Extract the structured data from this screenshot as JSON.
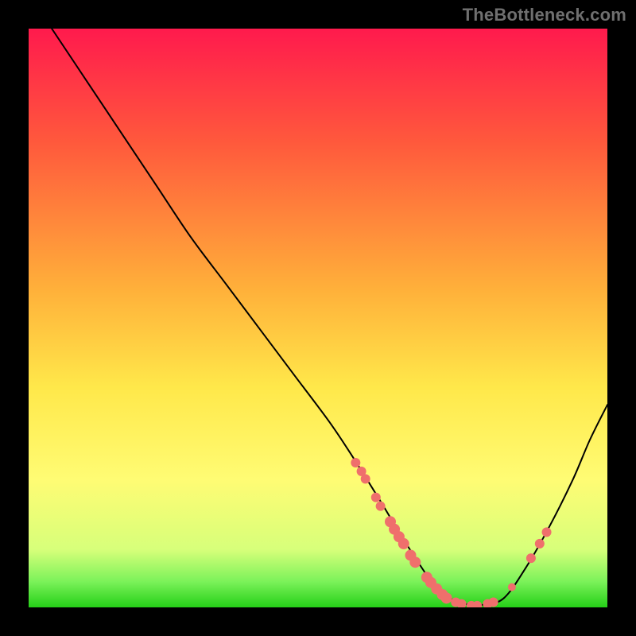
{
  "watermark": "TheBottleneck.com",
  "accent_color": "#ef6f6c",
  "curve_color": "#000000",
  "green_band_top": "#7cf25a",
  "green_band_bottom": "#25d018",
  "chart_data": {
    "type": "line",
    "title": "",
    "xlabel": "",
    "ylabel": "",
    "xlim": [
      0,
      100
    ],
    "ylim": [
      0,
      100
    ],
    "grid": false,
    "background_gradient": [
      {
        "pos": 0.0,
        "color": "#ff1a4d"
      },
      {
        "pos": 0.2,
        "color": "#ff5a3c"
      },
      {
        "pos": 0.45,
        "color": "#ffb03a"
      },
      {
        "pos": 0.62,
        "color": "#ffe84a"
      },
      {
        "pos": 0.78,
        "color": "#fffc74"
      },
      {
        "pos": 0.9,
        "color": "#d7ff7a"
      },
      {
        "pos": 0.955,
        "color": "#7cf25a"
      },
      {
        "pos": 1.0,
        "color": "#25d018"
      }
    ],
    "series": [
      {
        "name": "bottleneck-curve",
        "x": [
          4,
          10,
          16,
          22,
          28,
          34,
          40,
          46,
          52,
          56,
          61,
          64,
          67.5,
          70,
          73,
          75,
          78,
          82,
          86,
          90,
          94,
          97,
          100
        ],
        "y": [
          100,
          91,
          82,
          73,
          64,
          56,
          48,
          40,
          32,
          26,
          18,
          13,
          7.5,
          4,
          1.5,
          0.7,
          0.4,
          1.5,
          7,
          14,
          22,
          29,
          35
        ]
      }
    ],
    "markers": [
      {
        "x": 56.5,
        "y": 25.0,
        "r": 6
      },
      {
        "x": 57.5,
        "y": 23.5,
        "r": 6
      },
      {
        "x": 58.2,
        "y": 22.2,
        "r": 6
      },
      {
        "x": 60.0,
        "y": 19.0,
        "r": 6
      },
      {
        "x": 60.8,
        "y": 17.5,
        "r": 6
      },
      {
        "x": 62.5,
        "y": 14.8,
        "r": 7
      },
      {
        "x": 63.2,
        "y": 13.5,
        "r": 7
      },
      {
        "x": 64.0,
        "y": 12.2,
        "r": 7
      },
      {
        "x": 64.8,
        "y": 11.0,
        "r": 7
      },
      {
        "x": 66.0,
        "y": 9.0,
        "r": 7
      },
      {
        "x": 66.8,
        "y": 7.8,
        "r": 7
      },
      {
        "x": 68.8,
        "y": 5.2,
        "r": 7
      },
      {
        "x": 69.5,
        "y": 4.3,
        "r": 7
      },
      {
        "x": 70.5,
        "y": 3.2,
        "r": 7
      },
      {
        "x": 71.5,
        "y": 2.2,
        "r": 7
      },
      {
        "x": 72.2,
        "y": 1.6,
        "r": 7
      },
      {
        "x": 73.8,
        "y": 0.9,
        "r": 6
      },
      {
        "x": 74.8,
        "y": 0.6,
        "r": 6
      },
      {
        "x": 76.5,
        "y": 0.3,
        "r": 6
      },
      {
        "x": 77.5,
        "y": 0.3,
        "r": 6
      },
      {
        "x": 79.3,
        "y": 0.6,
        "r": 6
      },
      {
        "x": 80.3,
        "y": 0.9,
        "r": 6
      },
      {
        "x": 83.5,
        "y": 3.5,
        "r": 5
      },
      {
        "x": 86.8,
        "y": 8.5,
        "r": 6
      },
      {
        "x": 88.3,
        "y": 11.0,
        "r": 6
      },
      {
        "x": 89.5,
        "y": 13.0,
        "r": 6
      }
    ]
  }
}
